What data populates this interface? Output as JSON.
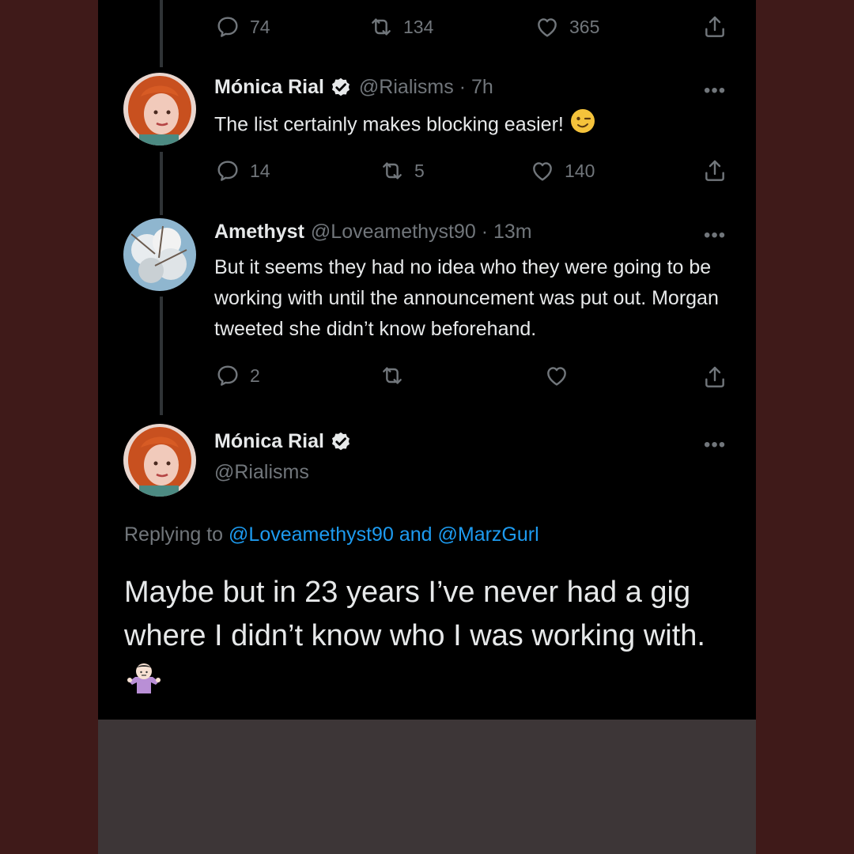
{
  "colors": {
    "background": "#3f1a19",
    "tweet_panel": "#000000",
    "bottom_panel": "#3d3637",
    "text": "#e7e9ea",
    "muted": "#71767b",
    "link": "#1d9bf0",
    "verified": "#e7e9ea"
  },
  "tweet0": {
    "reply_count": "74",
    "retweet_count": "134",
    "like_count": "365",
    "icons": [
      "reply-icon",
      "retweet-icon",
      "like-icon",
      "share-icon"
    ]
  },
  "tweet1": {
    "name": "Mónica Rial",
    "handle_time": "@Rialisms · 7h",
    "text": "The list certainly makes blocking easier!",
    "emoji": "wink-emoji",
    "reply_count": "14",
    "retweet_count": "5",
    "like_count": "140"
  },
  "tweet2": {
    "name": "Amethyst",
    "handle_time": "@Loveamethyst90 · 13m",
    "text": "But it seems they had no idea who they were going to be working with until the announcement was put out. Morgan tweeted she didn’t know beforehand.",
    "reply_count": "2",
    "retweet_count": "",
    "like_count": ""
  },
  "main_tweet": {
    "name": "Mónica Rial",
    "handle": "@Rialisms",
    "replying_prefix": "Replying to",
    "replying_user1": "@Loveamethyst90",
    "replying_and": "and",
    "replying_user2": "@MarzGurl",
    "text": "Maybe but in 23 years I’ve never had a gig where I didn’t know who I was working with.",
    "emoji": "shrug-emoji"
  },
  "more_label": "•••"
}
